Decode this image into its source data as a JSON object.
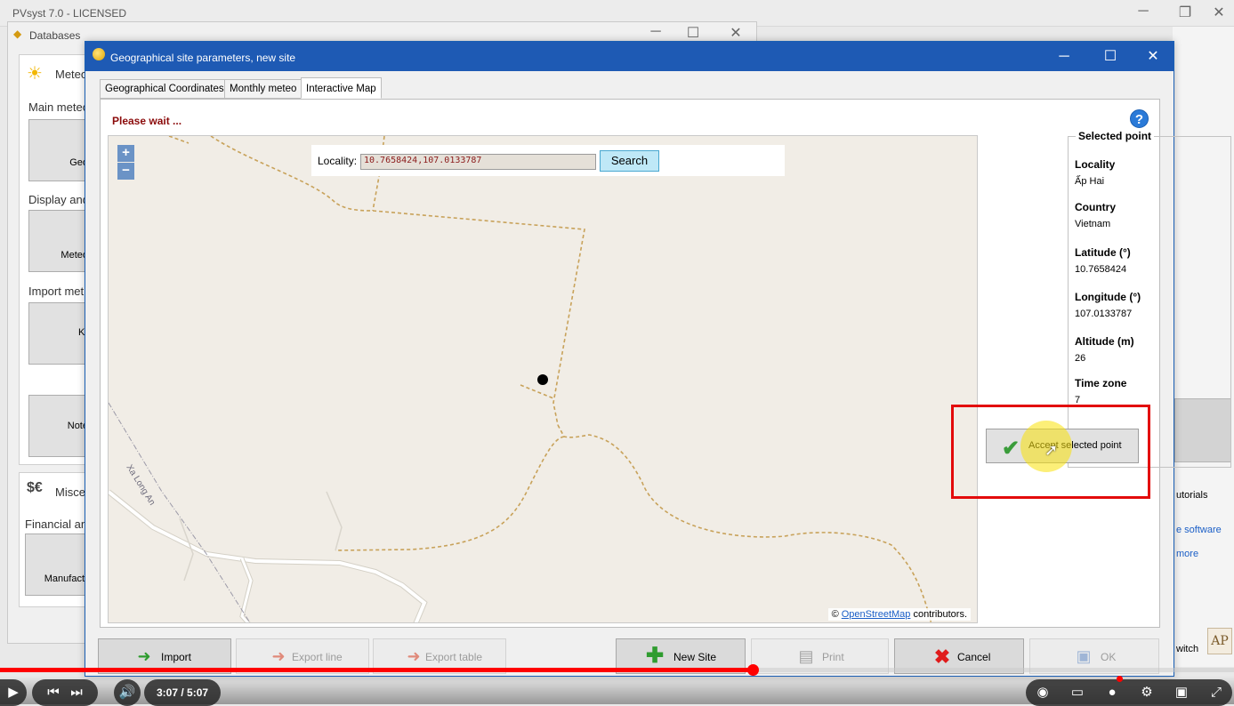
{
  "main_window": {
    "title": "PVsyst 7.0 - LICENSED",
    "right_snippets": [
      "utorials",
      "e software",
      "more",
      "witch"
    ]
  },
  "databases_window": {
    "title": "Databases",
    "sections": [
      "Meteo",
      "Main meteo",
      "Display and",
      "Import met",
      "Misce",
      "Financial an"
    ],
    "tiles": [
      "Geo",
      "Meteo",
      "Kr",
      "Note",
      "Manufact"
    ]
  },
  "dialog": {
    "title": "Geographical site parameters, new site",
    "tabs": [
      "Geographical Coordinates",
      "Monthly meteo",
      "Interactive Map"
    ],
    "active_tab": 2,
    "wait_message": "Please wait ...",
    "help_icon_text": "?",
    "map": {
      "zoom_in": "+",
      "zoom_out": "−",
      "locality_label": "Locality:",
      "locality_value": "10.7658424,107.0133787",
      "search_label": "Search",
      "road_label": "Xa Long An",
      "attribution_prefix": "©",
      "attribution_link": "OpenStreetMap",
      "attribution_suffix": "contributors."
    },
    "selected_point": {
      "legend": "Selected point",
      "fields": [
        {
          "label": "Locality",
          "value": "Ấp Hai"
        },
        {
          "label": "Country",
          "value": "Vietnam"
        },
        {
          "label": "Latitude (°)",
          "value": "10.7658424"
        },
        {
          "label": "Longitude (°)",
          "value": "107.0133787"
        },
        {
          "label": "Altitude (m)",
          "value": "26"
        },
        {
          "label": "Time zone",
          "value": "7"
        }
      ],
      "accept_label": "Accept selected point"
    },
    "buttons": {
      "import": "Import",
      "export_line": "Export line",
      "export_table": "Export table",
      "new_site": "New Site",
      "print": "Print",
      "cancel": "Cancel",
      "ok": "OK"
    }
  },
  "player": {
    "time": "3:07 / 5:07",
    "progress_fraction": 0.61
  },
  "colors": {
    "dialog_titlebar": "#1e5ab4",
    "wait_text": "#8b0b0b",
    "highlight_box": "#e30b0b",
    "cursor_highlight": "#fae10a",
    "progress": "#ff0000",
    "road_dashed": "#c8a25a"
  }
}
